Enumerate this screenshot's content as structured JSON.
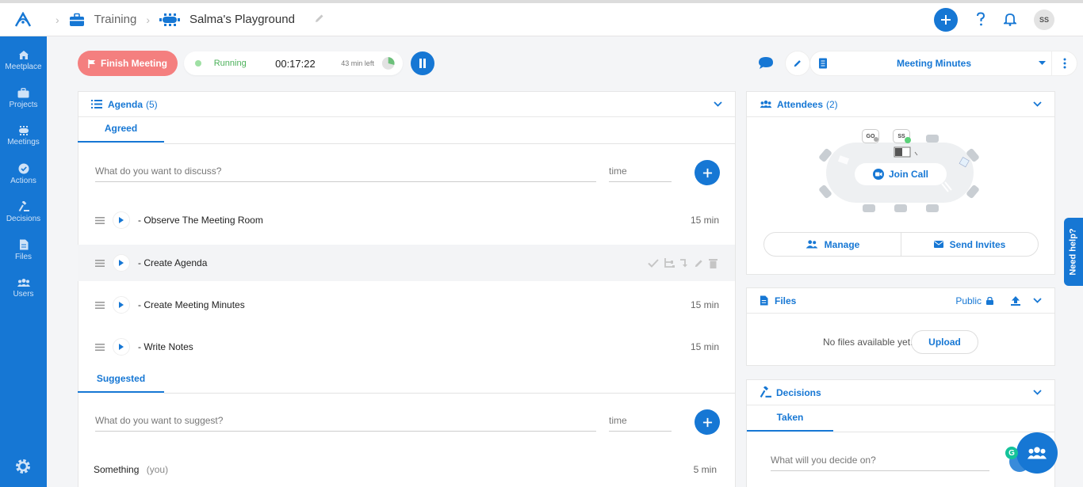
{
  "breadcrumb": {
    "project": "Training",
    "meeting": "Salma's Playground"
  },
  "user": {
    "initials": "SS"
  },
  "sidebar": {
    "items": [
      {
        "label": "Meetplace",
        "icon": "home-icon"
      },
      {
        "label": "Projects",
        "icon": "briefcase-icon"
      },
      {
        "label": "Meetings",
        "icon": "meeting-table-icon"
      },
      {
        "label": "Actions",
        "icon": "check-circle-icon"
      },
      {
        "label": "Decisions",
        "icon": "gavel-icon"
      },
      {
        "label": "Files",
        "icon": "file-icon"
      },
      {
        "label": "Users",
        "icon": "users-icon"
      }
    ]
  },
  "meeting_bar": {
    "finish_label": "Finish Meeting",
    "status": "Running",
    "timer": "00:17:22",
    "time_left": "43 min left",
    "elapsed_fraction": 0.29,
    "minutes_label": "Meeting Minutes"
  },
  "agenda": {
    "title": "Agenda",
    "count": "(5)",
    "tab_agreed": "Agreed",
    "discuss_placeholder": "What do you want to discuss?",
    "time_placeholder": "time",
    "items": [
      {
        "title": "- Observe The Meeting Room",
        "duration": "15 min"
      },
      {
        "title": "- Create Agenda",
        "duration": ""
      },
      {
        "title": "- Create Meeting Minutes",
        "duration": "15 min"
      },
      {
        "title": "- Write Notes",
        "duration": "15 min"
      }
    ],
    "tab_suggested": "Suggested",
    "suggest_placeholder": "What do you want to suggest?",
    "suggested_items": [
      {
        "title": "Something",
        "owner": "(you)",
        "duration": "5 min"
      }
    ]
  },
  "attendees": {
    "title": "Attendees",
    "count": "(2)",
    "seat_initials": [
      "GO",
      "SS"
    ],
    "join_label": "Join Call",
    "manage_label": "Manage",
    "invite_label": "Send Invites"
  },
  "files": {
    "title": "Files",
    "visibility": "Public",
    "empty_text": "No files available yet.",
    "upload_label": "Upload"
  },
  "decisions": {
    "title": "Decisions",
    "tab_taken": "Taken",
    "decide_placeholder": "What will you decide on?"
  },
  "help_label": "Need help?",
  "colors": {
    "primary": "#1677d4",
    "danger": "#f47f7f",
    "success": "#4cb15a"
  }
}
